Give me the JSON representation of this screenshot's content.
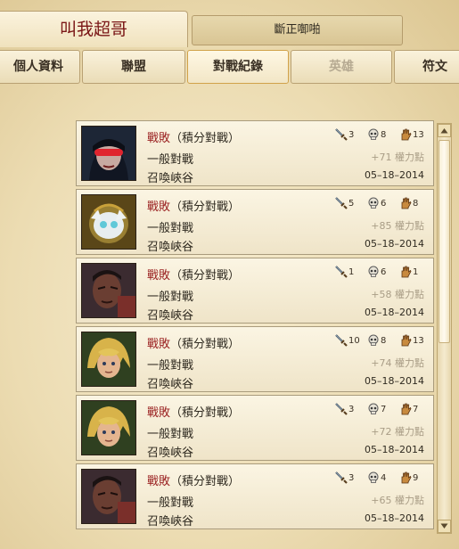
{
  "header": {
    "player_name": "叫我超哥",
    "secondary_name": "斷正啣啪"
  },
  "nav": {
    "tabs": [
      {
        "label": "個人資料",
        "state": "normal"
      },
      {
        "label": "聯盟",
        "state": "normal"
      },
      {
        "label": "對戰紀錄",
        "state": "active"
      },
      {
        "label": "英雄",
        "state": "disabled"
      },
      {
        "label": "符文",
        "state": "normal"
      }
    ]
  },
  "matches": [
    {
      "result": "戰敗",
      "mode": "（積分對戰）",
      "type": "一般對戰",
      "map": "召喚峽谷",
      "kills": "3",
      "deaths": "8",
      "assists": "13",
      "ip": "+71 權力點",
      "date": "05–18–2014",
      "champion_icon": "portrait-dark-goggles"
    },
    {
      "result": "戰敗",
      "mode": "（積分對戰）",
      "type": "一般對戰",
      "map": "召喚峽谷",
      "kills": "5",
      "deaths": "6",
      "assists": "8",
      "ip": "+85 權力點",
      "date": "05–18–2014",
      "champion_icon": "portrait-white-creature"
    },
    {
      "result": "戰敗",
      "mode": "（積分對戰）",
      "type": "一般對戰",
      "map": "召喚峽谷",
      "kills": "1",
      "deaths": "6",
      "assists": "1",
      "ip": "+58 權力點",
      "date": "05–18–2014",
      "champion_icon": "portrait-dark-man"
    },
    {
      "result": "戰敗",
      "mode": "（積分對戰）",
      "type": "一般對戰",
      "map": "召喚峽谷",
      "kills": "10",
      "deaths": "8",
      "assists": "13",
      "ip": "+74 權力點",
      "date": "05–18–2014",
      "champion_icon": "portrait-blond-hero"
    },
    {
      "result": "戰敗",
      "mode": "（積分對戰）",
      "type": "一般對戰",
      "map": "召喚峽谷",
      "kills": "3",
      "deaths": "7",
      "assists": "7",
      "ip": "+72 權力點",
      "date": "05–18–2014",
      "champion_icon": "portrait-blond-hero"
    },
    {
      "result": "戰敗",
      "mode": "（積分對戰）",
      "type": "一般對戰",
      "map": "召喚峽谷",
      "kills": "3",
      "deaths": "4",
      "assists": "9",
      "ip": "+65 權力點",
      "date": "05–18–2014",
      "champion_icon": "portrait-dark-man"
    }
  ],
  "colors": {
    "result_lost": "#9b2323",
    "accent_tab": "#d1a24a",
    "name_red": "#7a1616"
  }
}
